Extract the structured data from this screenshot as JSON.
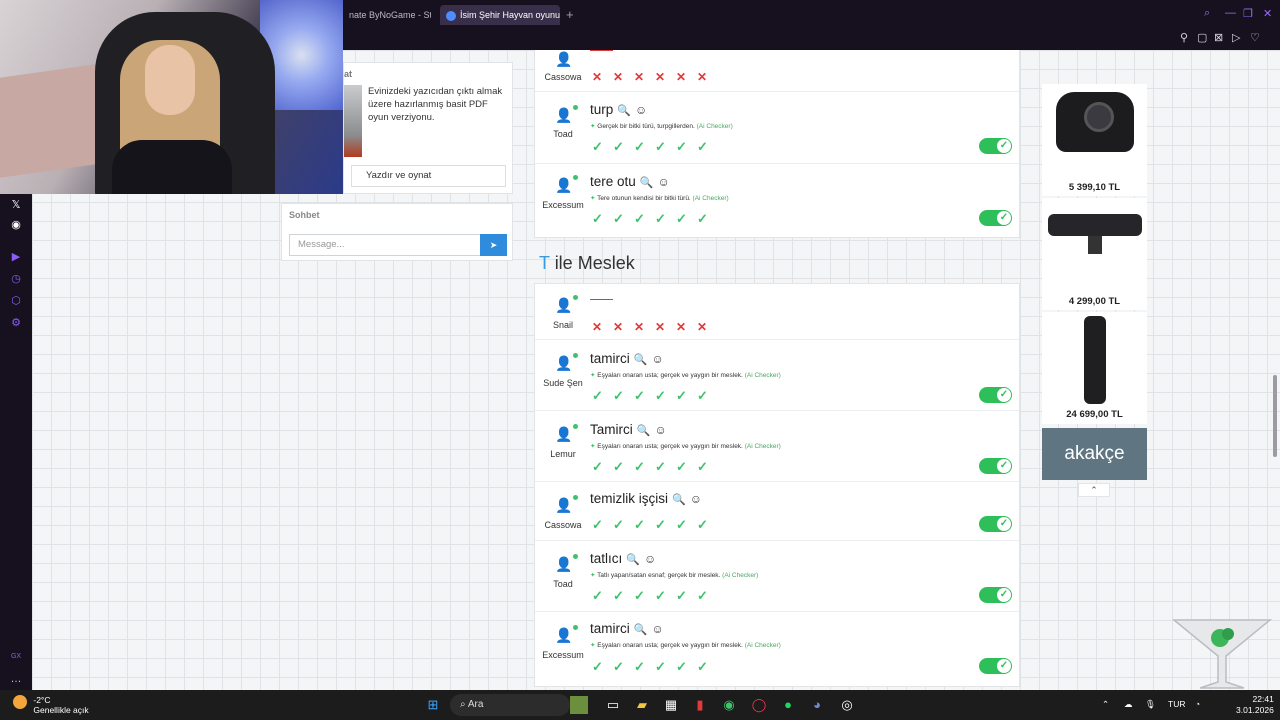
{
  "browser": {
    "tabs": [
      {
        "label": "nate ByNoGame - Strea"
      },
      {
        "label": "İsim Şehir Hayvan oyunun"
      }
    ]
  },
  "left_panel": {
    "title": "at",
    "text": "Evinizdeki yazıcıdan çıktı almak üzere hazırlanmış basit PDF oyun verziyonu.",
    "button": "Yazdır ve oynat"
  },
  "chat": {
    "title": "Sohbet",
    "placeholder": "Message..."
  },
  "card1": {
    "rows": [
      {
        "player": "Cassowa",
        "answer": "",
        "invalid": true
      },
      {
        "player": "Toad",
        "answer": "turp",
        "checker": "Gerçek bir bitki türü, turpgillerden.",
        "ai_label": "(Ai Checker)"
      },
      {
        "player": "Excessum",
        "answer": "tere otu",
        "checker": "Tere otunun kendisi bir bitki türü.",
        "ai_label": "(Ai Checker)"
      }
    ]
  },
  "section2": {
    "letter": "T",
    "title": "ile Meslek",
    "rows": [
      {
        "player": "Snail",
        "answer": "",
        "invalid": true
      },
      {
        "player": "Sude Şen",
        "answer": "tamirci",
        "checker": "Eşyaları onaran usta; gerçek ve yaygın bir meslek.",
        "ai_label": "(Ai Checker)"
      },
      {
        "player": "Lemur",
        "answer": "Tamirci",
        "checker": "Eşyaları onaran usta; gerçek ve yaygın bir meslek.",
        "ai_label": "(Ai Checker)"
      },
      {
        "player": "Cassowa",
        "answer": "temizlik işçisi",
        "checker": "",
        "ai_label": ""
      },
      {
        "player": "Toad",
        "answer": "tatlıcı",
        "checker": "Tatlı yapan/satan esnaf; gerçek bir meslek.",
        "ai_label": "(Ai Checker)"
      },
      {
        "player": "Excessum",
        "answer": "tamirci",
        "checker": "Eşyaları onaran usta; gerçek ve yaygın bir meslek.",
        "ai_label": "(Ai Checker)"
      }
    ]
  },
  "ads": [
    {
      "price": "5 399,10 TL"
    },
    {
      "price": "4 299,00 TL"
    },
    {
      "price": "24 699,00 TL"
    }
  ],
  "akakce": "akakçe",
  "taskbar": {
    "temp": "-2°C",
    "weather": "Genellikle açık",
    "search": "Ara",
    "lang": "TUR",
    "time": "22:41",
    "date": "3.01.2026"
  },
  "colors": {
    "accent": "#3b9be0",
    "ok": "#3cc36b",
    "bad": "#e03a3a",
    "toggle": "#2fbf5a"
  }
}
